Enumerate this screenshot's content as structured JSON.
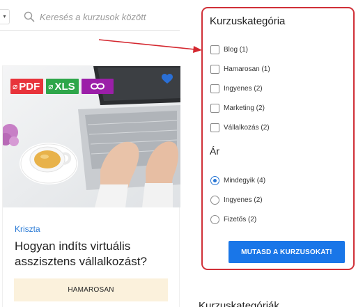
{
  "search": {
    "placeholder": "Keresés a kurzusok között",
    "caret": "▾",
    "icon": "search-icon"
  },
  "course_card": {
    "badges": {
      "pdf": "PDF",
      "xls": "XLS",
      "link_icon": "link-icon"
    },
    "favorite_icon": "heart-icon",
    "author": "Kriszta",
    "title": "Hogyan indíts virtuális asszisztens vállalkozást?",
    "status_button": "HAMAROSAN",
    "colors": {
      "pdf": "#e8333b",
      "xls": "#2ea64a",
      "link": "#9b1fa8",
      "heart": "#2a6fd6",
      "author": "#2b7bd6",
      "status_bg": "#fbf1dc"
    }
  },
  "filter_panel": {
    "category_title": "Kurzuskategória",
    "categories": [
      {
        "label": "Blog (1)",
        "checked": false
      },
      {
        "label": "Hamarosan (1)",
        "checked": false
      },
      {
        "label": "Ingyenes (2)",
        "checked": false
      },
      {
        "label": "Marketing (2)",
        "checked": false
      },
      {
        "label": "Vállalkozás (2)",
        "checked": false
      }
    ],
    "price_title": "Ár",
    "prices": [
      {
        "label": "Mindegyik (4)",
        "checked": true
      },
      {
        "label": "Ingyenes (2)",
        "checked": false
      },
      {
        "label": "Fizetős (2)",
        "checked": false
      }
    ],
    "submit": "MUTASD A KURZUSOKAT!",
    "colors": {
      "highlight_border": "#d03038",
      "button": "#1976e8",
      "radio_selected": "#2a77d4"
    }
  },
  "next_heading": "Kurzuskategóriák"
}
